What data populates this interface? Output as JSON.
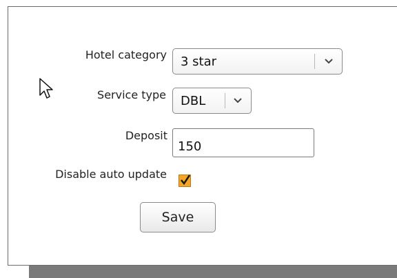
{
  "form": {
    "hotel_category": {
      "label": "Hotel category",
      "selected": "3 star",
      "dropdown_icon": "chevron-down-icon"
    },
    "service_type": {
      "label": "Service type",
      "selected": "DBL",
      "dropdown_icon": "chevron-down-icon"
    },
    "deposit": {
      "label": "Deposit",
      "value": "150"
    },
    "disable_auto_update": {
      "label": "Disable auto update",
      "checked": true,
      "check_color": "#f5a623"
    },
    "save_label": "Save"
  },
  "cursor": {
    "icon": "mouse-pointer-icon"
  },
  "colors": {
    "checkbox_accent": "#f5a623",
    "panel_border": "#6b6b6b",
    "shadow": "#7a7a7a"
  }
}
